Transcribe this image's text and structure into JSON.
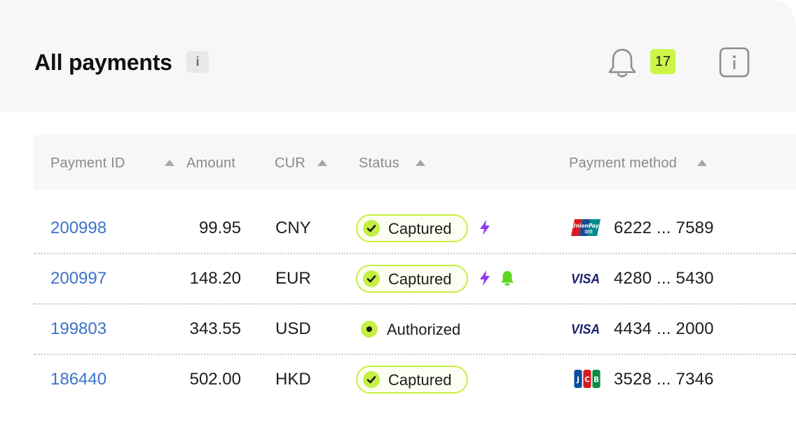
{
  "header": {
    "title": "All payments",
    "title_info_label": "i",
    "notification_icon": "bell-icon",
    "notification_count": "17",
    "info_icon": "info-icon"
  },
  "table": {
    "columns": [
      {
        "label": "Payment ID",
        "sort_icon": "sort-up-icon"
      },
      {
        "label": "Amount"
      },
      {
        "label": "CUR",
        "sort_icon": "sort-up-icon"
      },
      {
        "label": "Status",
        "sort_icon": "sort-up-icon"
      },
      {
        "label": "Payment method",
        "sort_icon": "sort-up-icon"
      }
    ],
    "rows": [
      {
        "payment_id": "200998",
        "amount": "99.95",
        "currency": "CNY",
        "status": "Captured",
        "status_icon": "check-circle-icon",
        "indicators": [
          "lightning-icon"
        ],
        "card_brand": "UnionPay",
        "card_number": "6222 ... 7589"
      },
      {
        "payment_id": "200997",
        "amount": "148.20",
        "currency": "EUR",
        "status": "Captured",
        "status_icon": "check-circle-icon",
        "indicators": [
          "lightning-icon",
          "bell-icon"
        ],
        "card_brand": "VISA",
        "card_number": "4280 ... 5430"
      },
      {
        "payment_id": "199803",
        "amount": "343.55",
        "currency": "USD",
        "status": "Authorized",
        "status_icon": "dot-icon",
        "indicators": [],
        "card_brand": "VISA",
        "card_number": "4434 ... 2000"
      },
      {
        "payment_id": "186440",
        "amount": "502.00",
        "currency": "HKD",
        "status": "Captured",
        "status_icon": "check-circle-icon",
        "indicators": [],
        "card_brand": "JCB",
        "card_number": "3528 ... 7346"
      }
    ]
  },
  "colors": {
    "accent_lime": "#ccf548",
    "link_blue": "#3b73c9",
    "lightning_purple": "#8b3ff0",
    "bell_green": "#5fd61e",
    "visa_blue": "#1a1f71"
  }
}
